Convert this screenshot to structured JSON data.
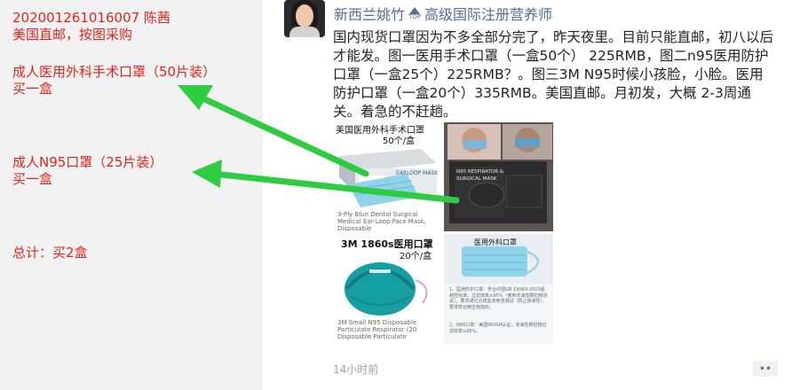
{
  "notes": {
    "order_id_name": "202001261016007   陈茜",
    "method": "美国直邮，按图采购",
    "item1_name": "成人医用外科手术口罩（50片装）",
    "item1_qty": "买一盒",
    "item2_name": "成人N95口罩（25片装）",
    "item2_qty": "买一盒",
    "total": "总计：买2盒"
  },
  "post": {
    "author": "新西兰姚竹",
    "top_badge": "TOP",
    "author_title": "高级国际注册营养师",
    "text": "国内现货口罩因为不多全部分完了，昨天夜里。目前只能直邮，初八以后才能发。图一医用手术口罩（一盒50个） 225RMB，图二n95医用防护口罩（一盒25个）225RMB？。图三3M N95时候小孩脸，小脸。医用防护口罩（一盒20个）335RMB。美国直邮。月初发，大概 2-3周通关。着急的不赶趟。",
    "timestamp": "14小时前",
    "more_label": "••"
  },
  "images": {
    "img1_title": "美国医用外科手术口罩",
    "img1_count": "50个/盒",
    "img1_box_label": "EARLOOP MASK",
    "img1_desc": "3-Ply Blue Dental Surgical Medical Ear-Loop Face Mask, Disposable",
    "img2_box_label": "N95 RESPIRATOR & SURGICAL MASK",
    "img3_title": "3M 1860s医用口罩",
    "img3_count": "20个/盒",
    "img3_desc": "3M Small N95 Disposable Particulate Respirator (20 Disposable Particulate",
    "img4_title": "医用外科口罩",
    "img4_note1": "1、医用防护口罩：符合中国GB 19083-2010强制性标准，过滤效率≥95%（使用非油性颗粒物测试），要求通过合成血液穿透测试（防止体液性）、要求符合微生物指标。",
    "img4_note2": "2、N95口罩：美国NIOSH认证，非油性颗粒物过滤效率≥95%。"
  },
  "colors": {
    "note_red": "#e0241b",
    "arrow_green": "#2ecc40",
    "link_blue": "#576b95",
    "mask_blue": "#7ec8e3",
    "n95_teal": "#169fa3"
  }
}
